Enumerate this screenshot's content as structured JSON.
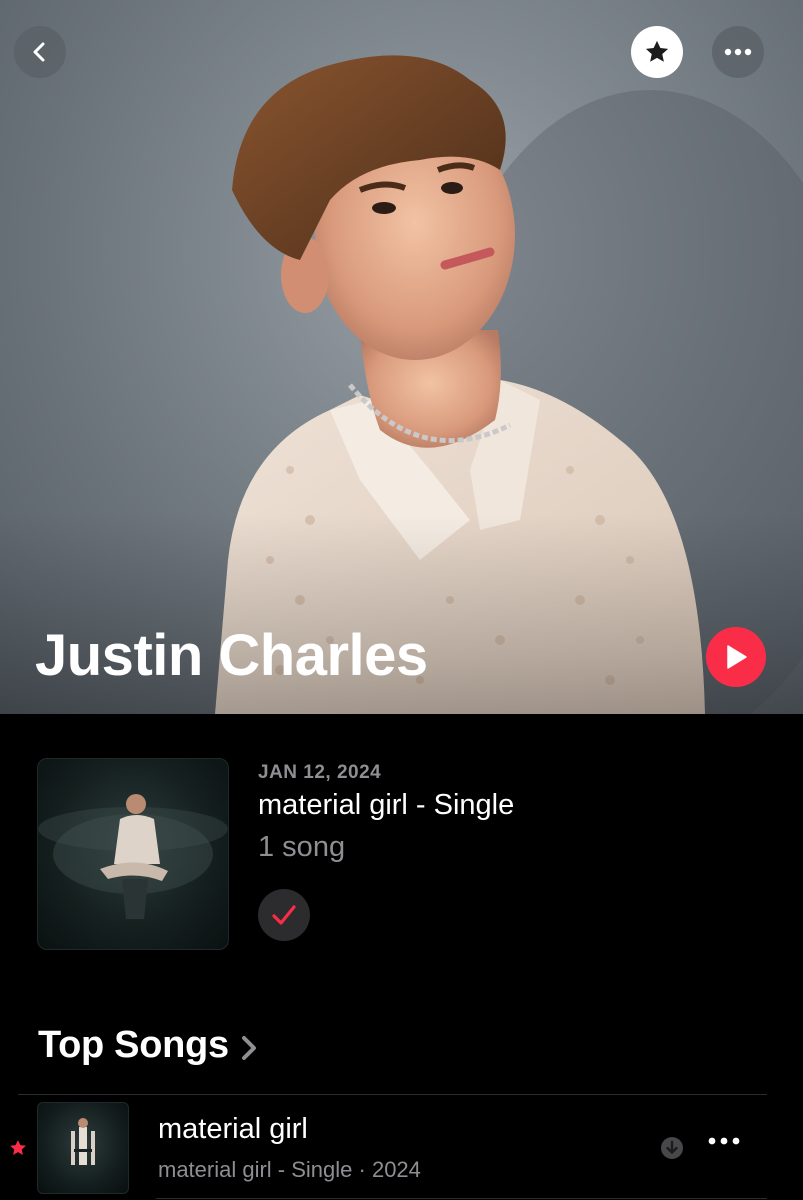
{
  "colors": {
    "accent": "#fa2d48",
    "secondary_text": "#8e8e93",
    "background": "#000000"
  },
  "nav": {
    "back_icon": "chevron-left-icon",
    "favorite_icon": "star-icon",
    "more_icon": "ellipsis-icon"
  },
  "hero": {
    "artist_name": "Justin Charles",
    "play_icon": "play-icon"
  },
  "latest_release": {
    "date": "JAN 12, 2024",
    "title": "material girl - Single",
    "song_count": "1 song",
    "added_icon": "checkmark-icon"
  },
  "top_songs": {
    "header": "Top Songs",
    "songs": [
      {
        "title": "material girl",
        "subtitle": "material girl - Single · 2024",
        "favorited": true,
        "downloaded": true
      }
    ]
  }
}
